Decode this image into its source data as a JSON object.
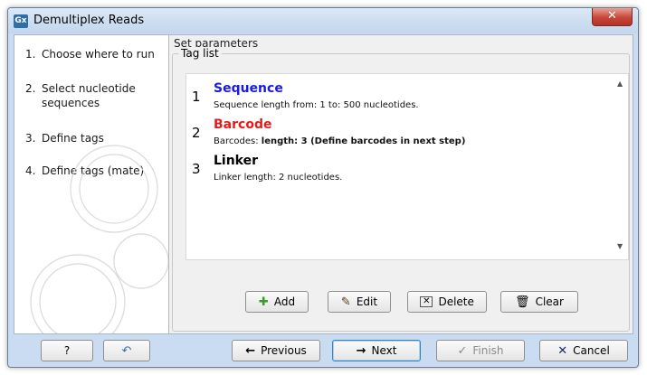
{
  "window": {
    "title": "Demultiplex Reads",
    "app_icon": "Gx",
    "close_glyph": "✕"
  },
  "steps": [
    {
      "num": "1.",
      "label": "Choose where to run"
    },
    {
      "num": "2.",
      "label": "Select nucleotide sequences"
    },
    {
      "num": "3.",
      "label": "Define tags"
    },
    {
      "num": "4.",
      "label": "Define tags (mate)"
    }
  ],
  "main": {
    "section_title": "Set parameters",
    "group_label": "Tag list",
    "tags": [
      {
        "num": "1",
        "name": "Sequence",
        "color": "#1a1ae6",
        "desc": "Sequence length from: 1 to: 500 nucleotides.",
        "desc_bold": ""
      },
      {
        "num": "2",
        "name": "Barcode",
        "color": "#e61a1a",
        "desc": "Barcodes: ",
        "desc_bold": "length: 3 (Define barcodes in next step)"
      },
      {
        "num": "3",
        "name": "Linker",
        "color": "#000000",
        "desc": "Linker length: 2 nucleotides.",
        "desc_bold": ""
      }
    ],
    "list_buttons": {
      "add": "Add",
      "edit": "Edit",
      "delete": "Delete",
      "clear": "Clear"
    }
  },
  "footer": {
    "help": "?",
    "previous": "Previous",
    "next": "Next",
    "finish": "Finish",
    "cancel": "Cancel"
  },
  "icons": {
    "add": "plus-icon",
    "edit": "pencil-icon",
    "delete": "delete-icon",
    "clear": "trash-icon",
    "previous": "arrow-left-icon",
    "next": "arrow-right-icon",
    "finish": "checkmark-icon",
    "cancel": "x-icon",
    "back": "undo-icon"
  }
}
